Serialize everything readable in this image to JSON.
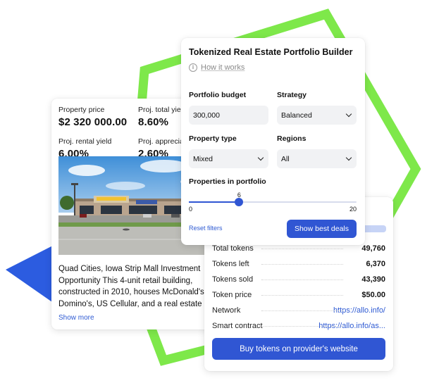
{
  "property": {
    "price_label": "Property price",
    "price_value": "$2 320 000.00",
    "total_yield_label": "Proj. total yield",
    "total_yield_value": "8.60%",
    "rental_yield_label": "Proj. rental yield",
    "rental_yield_value": "6.00%",
    "appreciation_label": "Proj. appreciatio",
    "appreciation_value": "2.60%",
    "description_lines": [
      "Quad Cities, Iowa Strip Mall Investment",
      "Opportunity This 4-unit retail building,",
      "constructed in 2010, houses McDonald's,",
      "Domino's, US Cellular, and a real estate offic"
    ],
    "show_more": "Show more"
  },
  "tokens": {
    "rows": [
      {
        "key": "Total tokens",
        "value": "49,760",
        "link": false
      },
      {
        "key": "Tokens left",
        "value": "6,370",
        "link": false
      },
      {
        "key": "Tokens sold",
        "value": "43,390",
        "link": false
      },
      {
        "key": "Token price",
        "value": "$50.00",
        "link": false
      },
      {
        "key": "Network",
        "value": "https://allo.info/",
        "link": true
      },
      {
        "key": "Smart contract",
        "value": "https://allo.info/as...",
        "link": true
      }
    ],
    "buy_button": "Buy tokens on provider's website"
  },
  "builder": {
    "title": "Tokenized Real Estate Portfolio Builder",
    "how_it_works": "How it works",
    "budget_label": "Portfolio budget",
    "budget_value": "300,000",
    "strategy_label": "Strategy",
    "strategy_value": "Balanced",
    "property_type_label": "Property type",
    "property_type_value": "Mixed",
    "regions_label": "Regions",
    "regions_value": "All",
    "properties_label": "Properties in portfolio",
    "slider": {
      "value": "6",
      "min": "0",
      "max": "20"
    },
    "reset_filters": "Reset filters",
    "show_best": "Show best deals"
  },
  "colors": {
    "accent": "#3056d3",
    "green_shape": "#7ee84a",
    "blue_shape": "#2c5ce0"
  }
}
